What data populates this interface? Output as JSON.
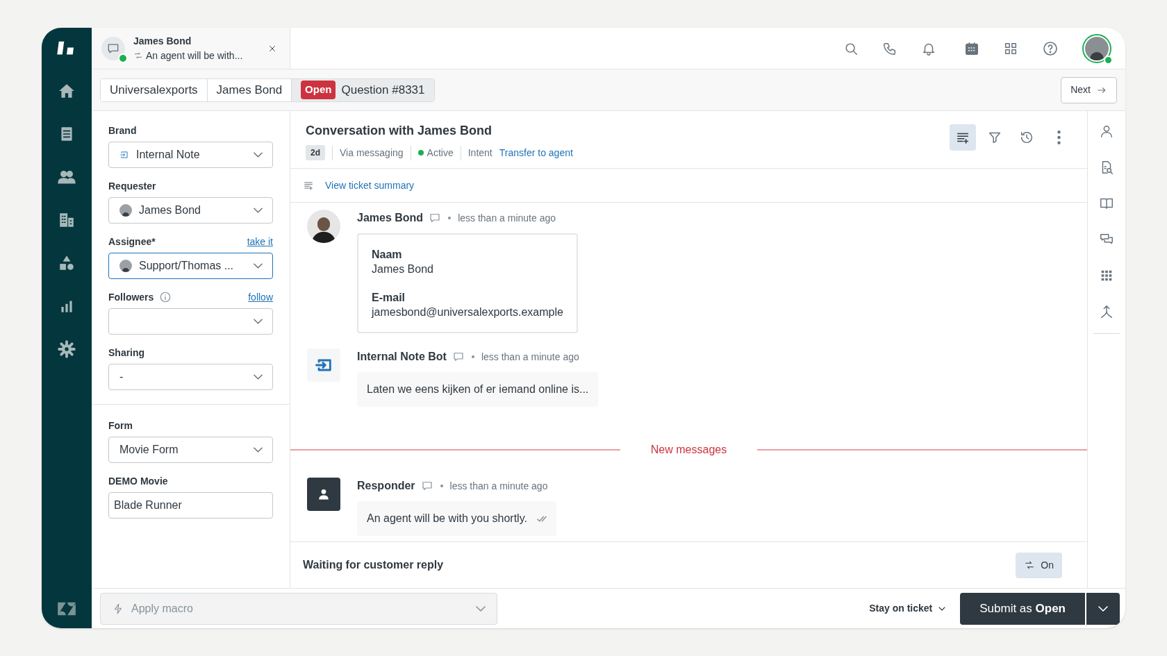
{
  "conversation_tab": {
    "name": "James Bond",
    "preview": "An agent will be with...",
    "online": true
  },
  "breadcrumbs": [
    {
      "label": "Universalexports",
      "selected": false
    },
    {
      "label": "James Bond",
      "selected": false
    },
    {
      "label": "Question #8331",
      "badge": "Open",
      "selected": true
    }
  ],
  "next_button": "Next",
  "field_groups": [
    [
      {
        "kind": "select",
        "label": "Brand",
        "value": "Internal Note",
        "leading": {
          "kind": "brand"
        },
        "focused": false
      },
      {
        "kind": "select",
        "label": "Requester",
        "value": "James Bond",
        "leading": {
          "kind": "avatar"
        },
        "focused": false
      },
      {
        "kind": "select",
        "label": "Assignee*",
        "link": "take it",
        "value": "Support/Thomas ...",
        "leading": {
          "kind": "avatar"
        },
        "focused": true
      },
      {
        "kind": "select",
        "label": "Followers",
        "info": true,
        "link": "follow",
        "focused": false
      },
      {
        "kind": "select",
        "label": "Sharing",
        "value": "-",
        "focused": false
      }
    ],
    [
      {
        "kind": "select",
        "label": "Form",
        "value": "Movie Form",
        "focused": false
      },
      {
        "kind": "input",
        "label": "DEMO Movie",
        "value": "Blade Runner",
        "focused": false
      }
    ]
  ],
  "conversation": {
    "title": "Conversation with James Bond",
    "age": "2d",
    "channel": "Via messaging",
    "status": "Active",
    "intent_label": "Intent",
    "intent": "Transfer to agent",
    "tools": [
      {
        "selected": true
      },
      {
        "selected": false
      },
      {
        "selected": false
      },
      {
        "selected": false
      }
    ],
    "summary_link": "View ticket summary"
  },
  "messages": [
    {
      "kind": "card",
      "avatar": {
        "kind": "person"
      },
      "author": "James Bond",
      "time": "less than a minute ago",
      "fields": [
        {
          "label": "Naam",
          "value": "James Bond"
        },
        {
          "label": "E-mail",
          "value": "jamesbond@universalexports.example"
        }
      ]
    },
    {
      "kind": "bubble",
      "avatar": {
        "kind": "bot"
      },
      "author": "Internal Note Bot",
      "time": "less than a minute ago",
      "text": "Laten we eens kijken of er iemand online is...",
      "delivered": false
    },
    {
      "kind": "divider",
      "text": "New messages"
    },
    {
      "kind": "bubble",
      "avatar": {
        "kind": "responder"
      },
      "author": "Responder",
      "time": "less than a minute ago",
      "text": "An agent will be with you shortly.",
      "delivered": true
    }
  ],
  "waiting": {
    "text": "Waiting for customer reply",
    "toggle": "On"
  },
  "bottom_bar": {
    "macro_placeholder": "Apply macro",
    "stay": "Stay on ticket",
    "submit": "Submit as **Open**"
  }
}
